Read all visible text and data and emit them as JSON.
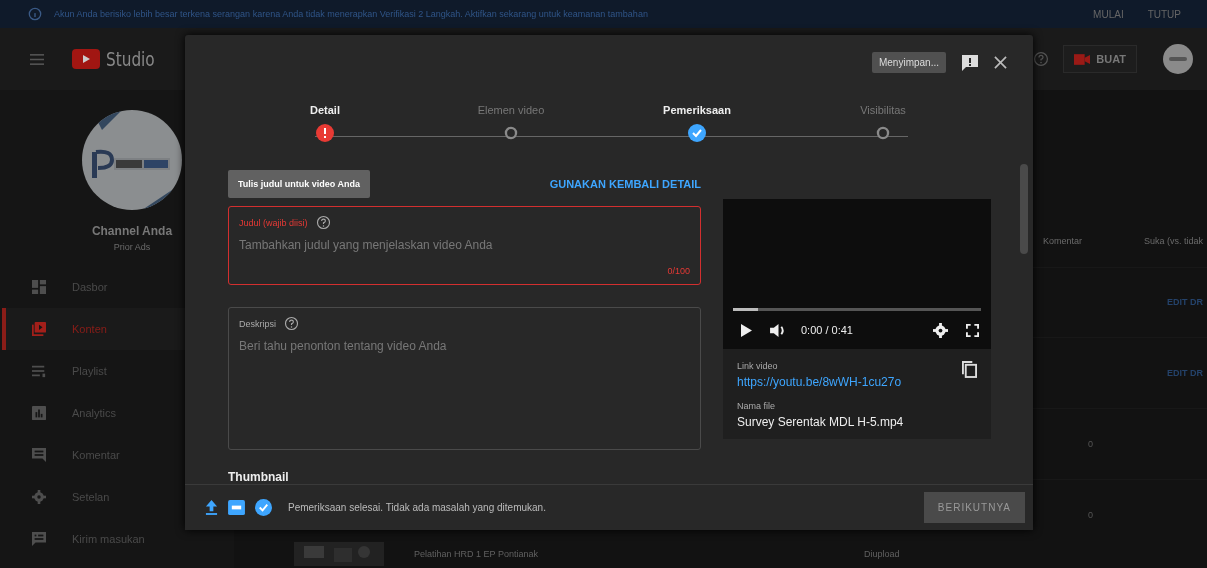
{
  "banner": {
    "message": "Akun Anda berisiko lebih besar terkena serangan karena Anda tidak menerapkan Verifikasi 2 Langkah. Aktifkan sekarang untuk keamanan tambahan",
    "buttons": [
      "MULAI",
      "TUTUP"
    ]
  },
  "topbar": {
    "logo_text": "Studio",
    "create_button": "BUAT"
  },
  "sidebar": {
    "channel_title": "Channel Anda",
    "channel_name": "Prior Ads",
    "items": [
      {
        "label": "Dasbor",
        "selected": false
      },
      {
        "label": "Konten",
        "selected": true
      },
      {
        "label": "Playlist",
        "selected": false
      },
      {
        "label": "Analytics",
        "selected": false
      },
      {
        "label": "Komentar",
        "selected": false
      },
      {
        "label": "Setelan",
        "selected": false
      },
      {
        "label": "Kirim masukan",
        "selected": false
      }
    ]
  },
  "content": {
    "columns": [
      "Komentar",
      "Suka (vs. tidak"
    ],
    "rows": [
      {
        "kind": "action",
        "text": "EDIT DR"
      },
      {
        "kind": "action",
        "text": "EDIT DR"
      },
      {
        "kind": "count",
        "text": "0"
      },
      {
        "kind": "count",
        "text": "0"
      }
    ],
    "bottom_row": {
      "title": "Pelatihan HRD 1 EP Pontianak",
      "status": "Diupload"
    }
  },
  "modal": {
    "save_status": "Menyimpan...",
    "steps": [
      {
        "label": "Detail",
        "kind": "error"
      },
      {
        "label": "Elemen video",
        "kind": "pending"
      },
      {
        "label": "Pemeriksaan",
        "kind": "done"
      },
      {
        "label": "Visibilitas",
        "kind": "pending"
      }
    ],
    "tooltip": "Tulis judul untuk video Anda",
    "reuse_button": "GUNAKAN KEMBALI DETAIL",
    "title_field": {
      "label": "Judul (wajib diisi)",
      "placeholder": "Tambahkan judul yang menjelaskan video Anda",
      "counter": "0/100",
      "error": true
    },
    "description_field": {
      "label": "Deskripsi",
      "placeholder": "Beri tahu penonton tentang video Anda"
    },
    "section_heading": "Thumbnail",
    "preview": {
      "time": "0:00 / 0:41",
      "level": 0.1,
      "link_label": "Link video",
      "link": "https://youtu.be/8wWH-1cu27o",
      "file_label": "Nama file",
      "file_name": "Survey Serentak MDL H-5.mp4"
    },
    "footer": {
      "status": "Pemeriksaan selesai. Tidak ada masalah yang ditemukan.",
      "next_button": "BERIKUTNYA",
      "next_disabled": true
    }
  }
}
